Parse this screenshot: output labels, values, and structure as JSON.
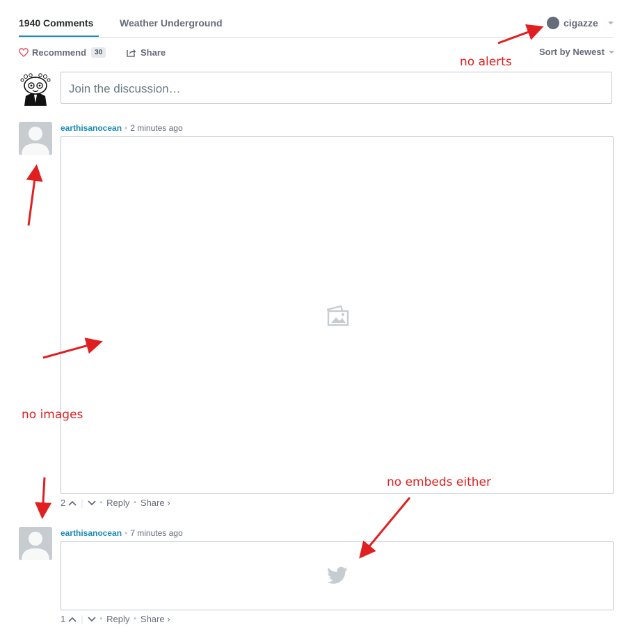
{
  "header": {
    "comments_tab": "1940 Comments",
    "site_tab": "Weather Underground",
    "user_name": "cigazze"
  },
  "toolbar": {
    "recommend_label": "Recommend",
    "recommend_count": "30",
    "share_label": "Share",
    "sort_label": "Sort by Newest"
  },
  "composer": {
    "placeholder": "Join the discussion…"
  },
  "comments": [
    {
      "author": "earthisanocean",
      "time": "2 minutes ago",
      "media_icon": "image-placeholder-icon",
      "votes": "2",
      "reply": "Reply",
      "share": "Share ›"
    },
    {
      "author": "earthisanocean",
      "time": "7 minutes ago",
      "media_icon": "twitter-icon",
      "votes": "1",
      "reply": "Reply",
      "share": "Share ›"
    }
  ],
  "annotations": {
    "alerts": "no alerts",
    "images": "no images",
    "embeds": "no embeds either"
  },
  "colors": {
    "annotation": "#e02020",
    "author_link": "#1a8ab8",
    "muted_text": "#656c7a",
    "border": "#c2c6cc"
  }
}
